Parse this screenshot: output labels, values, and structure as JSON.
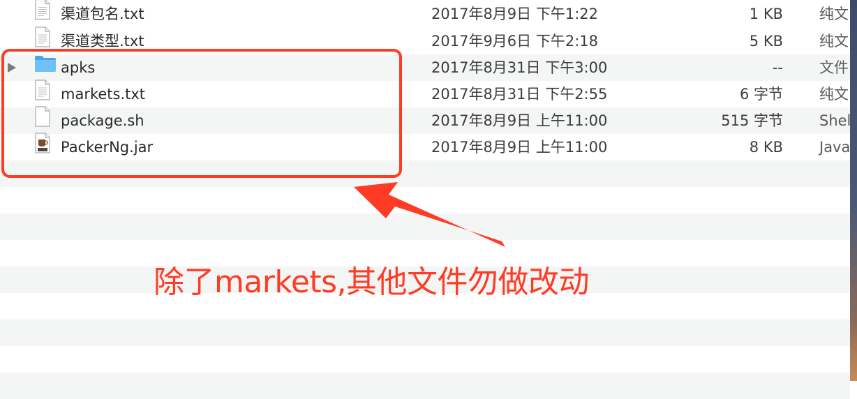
{
  "files": [
    {
      "name": "渠道包名.txt",
      "date": "2017年8月9日 下午1:22",
      "size": "1 KB",
      "kind": "纯文",
      "icon": "text-file-icon",
      "disclosure": false
    },
    {
      "name": "渠道类型.txt",
      "date": "2017年9月6日 下午2:18",
      "size": "5 KB",
      "kind": "纯文",
      "icon": "text-file-icon",
      "disclosure": false
    },
    {
      "name": "apks",
      "date": "2017年8月31日 下午3:00",
      "size": "--",
      "kind": "文件",
      "icon": "folder-icon",
      "disclosure": true
    },
    {
      "name": "markets.txt",
      "date": "2017年8月31日 下午2:55",
      "size": "6 字节",
      "kind": "纯文",
      "icon": "text-file-icon",
      "disclosure": false
    },
    {
      "name": "package.sh",
      "date": "2017年8月9日 上午11:00",
      "size": "515 字节",
      "kind": "Shel",
      "icon": "shell-script-icon",
      "disclosure": false
    },
    {
      "name": "PackerNg.jar",
      "date": "2017年8月9日 上午11:00",
      "size": "8 KB",
      "kind": "Java",
      "icon": "jar-file-icon",
      "disclosure": false
    }
  ],
  "annotation": {
    "text": "除了markets,其他文件勿做改动",
    "color": "#ff3b24"
  },
  "colors": {
    "highlight": "#ff3b24",
    "folder": "#5fb4f0",
    "row_alt": "#f4f5f5"
  }
}
